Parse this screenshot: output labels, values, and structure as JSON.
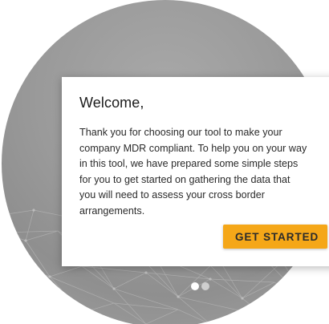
{
  "colors": {
    "accent": "#f5a718",
    "background_gray": "#9a9a9a",
    "dialog_bg": "#ffffff"
  },
  "dialog": {
    "title": "Welcome,",
    "body_lines": [
      "Thank you for choosing our tool to make your",
      "company MDR compliant. To help you on your way",
      "in this tool, we have prepared some simple steps",
      "for you to get started on gathering the data that",
      "you will need to assess your cross border",
      "arrangements."
    ],
    "button_label": "GET STARTED"
  },
  "pager": {
    "total": 2,
    "active_index": 0
  },
  "background": {
    "icon": "network-map-background"
  }
}
